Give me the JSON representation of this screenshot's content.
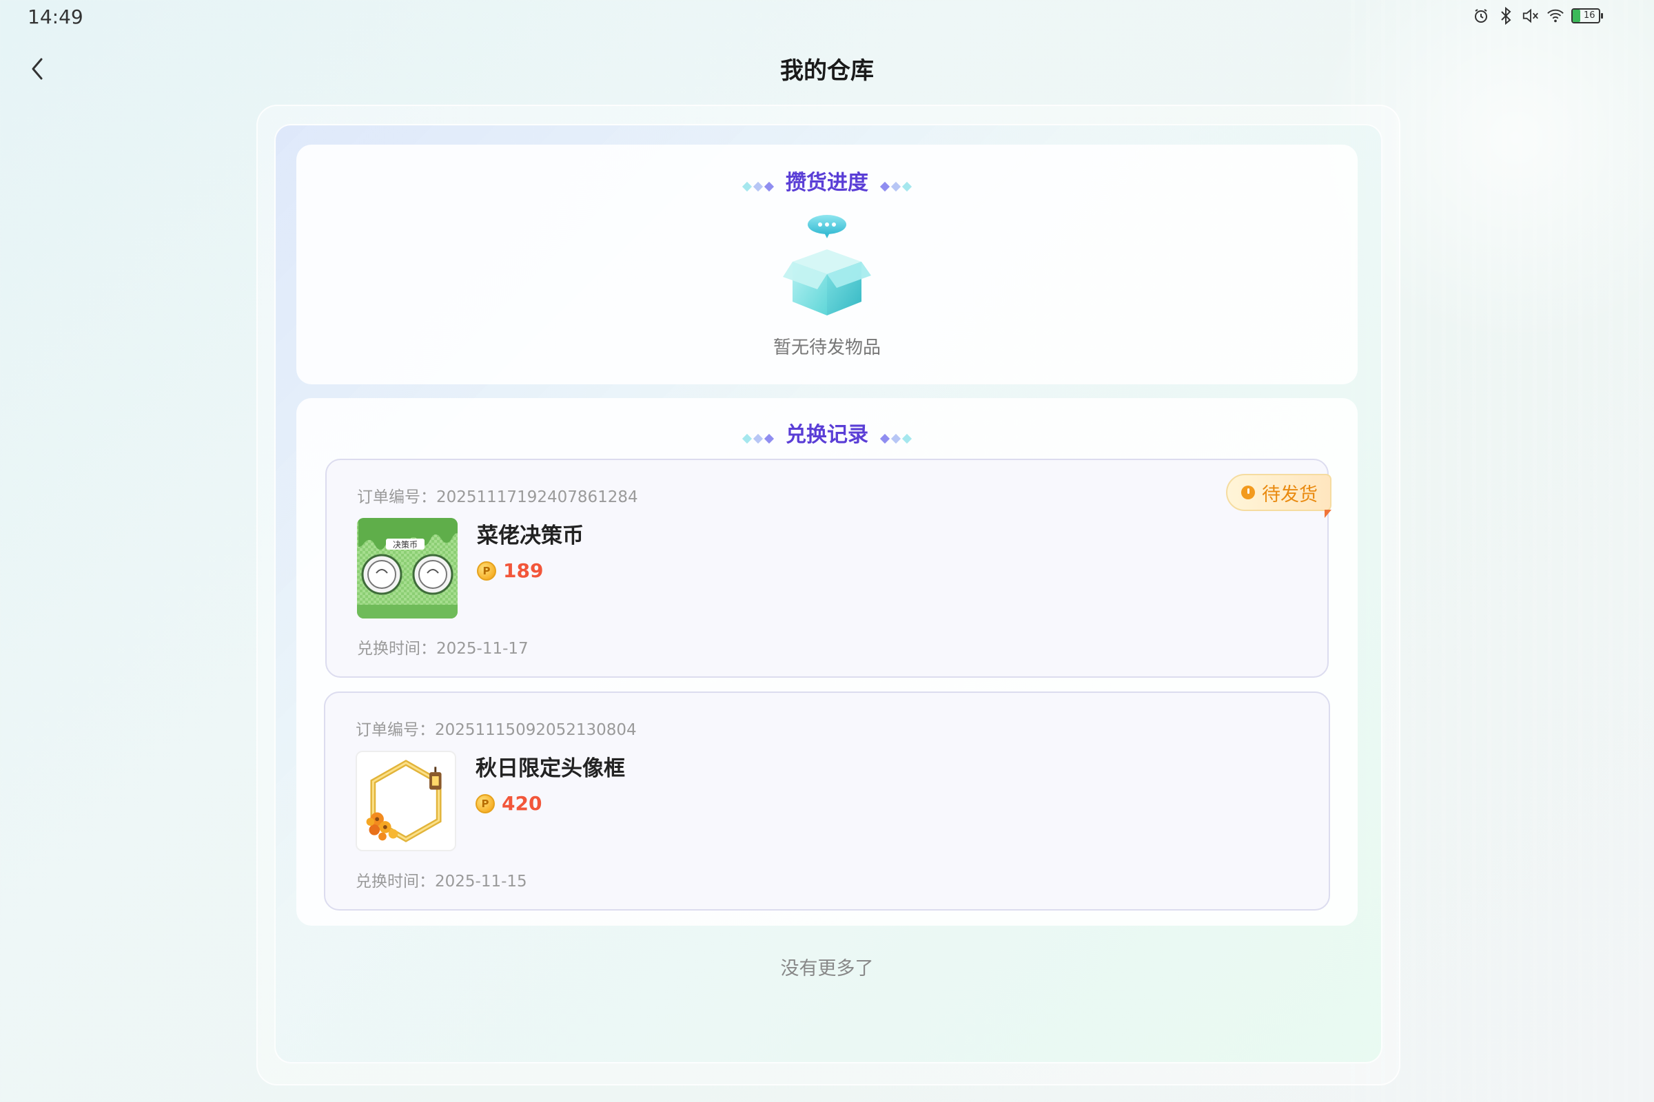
{
  "status_bar": {
    "time": "14:49",
    "battery_level": "16",
    "icons": [
      "alarm-icon",
      "bluetooth-icon",
      "mute-icon",
      "wifi-icon",
      "battery-icon"
    ]
  },
  "header": {
    "title": "我的仓库",
    "back_icon": "chevron-left-icon"
  },
  "progress_section": {
    "title": "攒货进度",
    "empty_text": "暂无待发物品"
  },
  "records_section": {
    "title": "兑换记录",
    "orders": [
      {
        "order_no": "订单编号：20251117192407861284",
        "name": "菜佬决策币",
        "price": "189",
        "time": "兑换时间：2025-11-17",
        "status": "待发货"
      },
      {
        "order_no": "订单编号：20251115092052130804",
        "name": "秋日限定头像框",
        "price": "420",
        "time": "兑换时间：2025-11-15"
      }
    ],
    "thumb1_text": "决策币"
  },
  "footer": {
    "no_more": "没有更多了"
  },
  "colors": {
    "accent_title": "#5a3ed6",
    "price": "#f2563a",
    "status_orange": "#e98a10"
  }
}
